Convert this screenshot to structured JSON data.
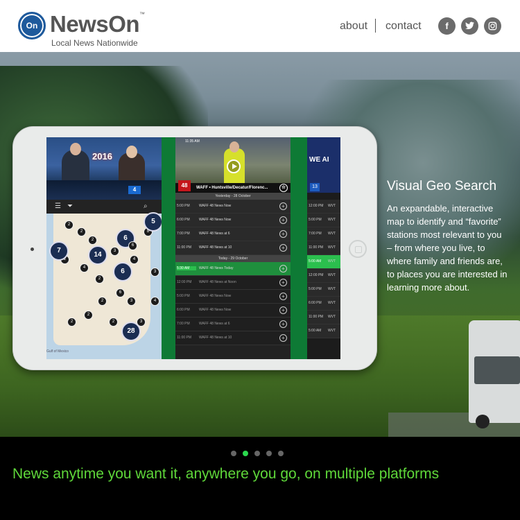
{
  "header": {
    "logo_badge": "On",
    "brand_name": "NewsOn",
    "brand_tm": "™",
    "tagline": "Local News Nationwide",
    "nav": {
      "about": "about",
      "contact": "contact"
    },
    "social": [
      {
        "icon": "facebook-icon",
        "glyph": "f"
      },
      {
        "icon": "twitter-icon",
        "glyph": "t"
      },
      {
        "icon": "instagram-icon",
        "glyph": "◎"
      }
    ]
  },
  "device_screen": {
    "left_panel": {
      "logo": "2016",
      "channel_badge": "4",
      "map_label": "Gulf of Mexico",
      "pins": [
        "2",
        "2",
        "2",
        "6",
        "3",
        "6",
        "8",
        "2",
        "4",
        "2",
        "6",
        "4",
        "3",
        "6",
        "2",
        "3",
        "2",
        "2",
        "3",
        "4",
        "5",
        "7",
        "2",
        "14",
        "28"
      ]
    },
    "list_panel": {
      "status_time": "11:35 AM",
      "station_logo": "48",
      "station_name": "WAFF • Huntsville/Decatur/Florenc...",
      "day1": "Yesterday - 28 October",
      "day1_rows": [
        {
          "time": "5:00 PM",
          "name": "WAFF 48 News Now"
        },
        {
          "time": "6:00 PM",
          "name": "WAFF 48 News Now"
        },
        {
          "time": "7:00 PM",
          "name": "WAFF 48 News at 6"
        },
        {
          "time": "11:00 PM",
          "name": "WAFF 48 News at 10"
        }
      ],
      "day2": "Today - 29 October",
      "day2_rows": [
        {
          "time": "5:30 AM",
          "name": "WAFF 48 News Today",
          "live": true
        },
        {
          "time": "12:00 PM",
          "name": "WAFF 48 News at Noon"
        },
        {
          "time": "5:00 PM",
          "name": "WAFF 48 News Now"
        },
        {
          "time": "6:00 PM",
          "name": "WAFF 48 News Now"
        },
        {
          "time": "7:00 PM",
          "name": "WAFF 48 News at 6"
        },
        {
          "time": "11:00 PM",
          "name": "WAFF 48 News at 10"
        }
      ]
    },
    "right_panel": {
      "status": "68%",
      "video_text": "WE AI",
      "logo": "13",
      "rows": [
        {
          "time": "12:00 PM",
          "name": "WVT"
        },
        {
          "time": "5:00 PM",
          "name": "WVT"
        },
        {
          "time": "7:00 PM",
          "name": "WVT"
        },
        {
          "time": "11:00 PM",
          "name": "WVT"
        },
        {
          "time": "5:00 AM",
          "name": "WVT",
          "live": true
        },
        {
          "time": "12:00 PM",
          "name": "WVT"
        },
        {
          "time": "5:00 PM",
          "name": "WVT"
        },
        {
          "time": "6:00 PM",
          "name": "WVT"
        },
        {
          "time": "11:00 PM",
          "name": "WVT"
        },
        {
          "time": "5:00 AM",
          "name": "WVT"
        }
      ]
    }
  },
  "feature": {
    "title": "Visual Geo Search",
    "body": "An expandable, interactive map to identify and “favorite” stations most relevant to you – from where you live, to where family and friends are, to places you are interested in learning more about."
  },
  "carousel": {
    "count": 5,
    "active_index": 1
  },
  "footer": {
    "slogan": "News anytime you want it, anywhere you go, on multiple platforms"
  },
  "colors": {
    "brand_blue": "#1e5a9c",
    "accent_green": "#5fd83a",
    "dot_active": "#2bd94e"
  }
}
